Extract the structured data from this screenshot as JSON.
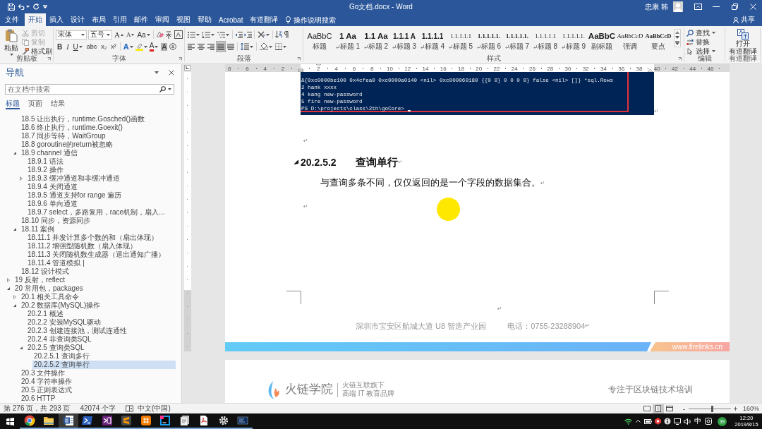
{
  "title_bar": {
    "title": "Go文档.docx - Word",
    "user": "忠康 韩"
  },
  "tabs": [
    {
      "label": "文件",
      "selected": false
    },
    {
      "label": "开始",
      "selected": true
    },
    {
      "label": "插入",
      "selected": false
    },
    {
      "label": "设计",
      "selected": false
    },
    {
      "label": "布局",
      "selected": false
    },
    {
      "label": "引用",
      "selected": false
    },
    {
      "label": "邮件",
      "selected": false
    },
    {
      "label": "审阅",
      "selected": false
    },
    {
      "label": "视图",
      "selected": false
    },
    {
      "label": "帮助",
      "selected": false
    },
    {
      "label": "Acrobat",
      "selected": false
    },
    {
      "label": "有道翻译",
      "selected": false
    }
  ],
  "tell_me": {
    "placeholder": "操作说明搜索"
  },
  "share": "共享",
  "ribbon": {
    "clipboard": {
      "paste": "粘贴",
      "buttons": [
        {
          "label": "剪切",
          "disabled": true
        },
        {
          "label": "复制",
          "disabled": true
        },
        {
          "label": "格式刷",
          "disabled": false
        }
      ],
      "group_label": "剪贴板"
    },
    "font": {
      "font_name": "宋体",
      "font_size": "五号",
      "grow": "A",
      "shrink": "A",
      "change_case": "Aa",
      "char_border": "A",
      "format_buttons": [
        "B",
        "I",
        "U",
        "abc",
        "x₂",
        "x²"
      ],
      "text_effects": "A",
      "font_color": "A",
      "char_shading": "A",
      "group_label": "字体"
    },
    "paragraph": {
      "align_buttons": [
        {
          "selected": false
        },
        {
          "selected": false
        },
        {
          "selected": false
        },
        {
          "selected": true
        },
        {
          "selected": false
        }
      ],
      "group_label": "段落"
    },
    "styles": {
      "items": [
        {
          "preview": "AaBbC",
          "label": "标题",
          "kind": "plain",
          "paragraph_mark": false
        },
        {
          "preview": "1 Aa",
          "label": "标题 1",
          "kind": "bold_large",
          "paragraph_mark": true
        },
        {
          "preview": "1.1 Aa",
          "label": "标题 2",
          "kind": "bold_large",
          "paragraph_mark": true
        },
        {
          "preview": "1.1.1 A",
          "label": "标题 3",
          "kind": "bold",
          "paragraph_mark": true
        },
        {
          "preview": "1.1.1.1",
          "label": "标题 4",
          "kind": "bold",
          "paragraph_mark": true
        },
        {
          "preview": "1.1.1.1.1",
          "label": "标题 5",
          "kind": "serif",
          "paragraph_mark": true
        },
        {
          "preview": "1.1.1.1.1.",
          "label": "标题 6",
          "kind": "bold_serif",
          "paragraph_mark": true
        },
        {
          "preview": "1.1.1.1.1.",
          "label": "标题 7",
          "kind": "bold_serif",
          "paragraph_mark": true
        },
        {
          "preview": "1.1.1.1.1",
          "label": "标题 8",
          "kind": "serif",
          "paragraph_mark": true
        },
        {
          "preview": "1.1.1.1.1.",
          "label": "标题 9",
          "kind": "serif",
          "paragraph_mark": true
        },
        {
          "preview": "AaBbC",
          "label": "副标题",
          "kind": "bold_large",
          "paragraph_mark": false
        },
        {
          "preview": "AaBbCcD",
          "label": "强调",
          "kind": "italic",
          "paragraph_mark": false
        },
        {
          "preview": "AaBbCcD",
          "label": "要点",
          "kind": "bold_serif",
          "paragraph_mark": false
        }
      ],
      "group_label": "样式"
    },
    "editing": {
      "buttons": [
        "查找",
        "替换",
        "选择"
      ],
      "group_label": "编辑"
    },
    "translate": {
      "button": [
        "打开",
        "有道翻译"
      ],
      "group_label": "有道翻译"
    }
  },
  "navigation": {
    "title": "导航",
    "search": {
      "placeholder": "在文档中搜索"
    },
    "tabs": [
      {
        "label": "标题",
        "selected": true
      },
      {
        "label": "页面",
        "selected": false
      },
      {
        "label": "结果",
        "selected": false
      }
    ],
    "headings": [
      {
        "children": [
          {
            "label": "18.5 让出执行，runtime.Gosched()函数",
            "selected": false
          },
          {
            "label": "18.6 终止执行，runtime.Goexit()",
            "selected": false
          },
          {
            "label": "18.7 同步等待，WaitGroup",
            "selected": false
          },
          {
            "label": "18.8 goroutine的return被忽略",
            "selected": false
          },
          {
            "label": "18.9 channel 通信",
            "selected": false,
            "expanded": true,
            "children": [
              {
                "label": "18.9.1 语法",
                "selected": false
              },
              {
                "label": "18.9.2 操作",
                "selected": false
              },
              {
                "label": "18.9.3 缓冲通道和非缓冲通道",
                "selected": false,
                "expanded": false
              },
              {
                "label": "18.9.4 关闭通道",
                "selected": false
              },
              {
                "label": "18.9.5 通道支持for range 遍历",
                "selected": false
              },
              {
                "label": "18.9.6 单向通道",
                "selected": false
              },
              {
                "label": "18.9.7 select，多路复用，race机制，扇入...",
                "selected": false
              }
            ]
          },
          {
            "label": "18.10 同步，资源同步",
            "selected": false
          },
          {
            "label": "18.11 案例",
            "selected": false,
            "expanded": true,
            "children": [
              {
                "label": "18.11.1 并发计算多个数的和（扇出体现）",
                "selected": false
              },
              {
                "label": "18.11.2 增强型随机数（扇入体现）",
                "selected": false
              },
              {
                "label": "18.11.3 关闭随机数生成器（退出通知广播）",
                "selected": false
              },
              {
                "label": "18.11.4 管道模拟 |",
                "selected": false
              }
            ]
          },
          {
            "label": "18.12 设计模式",
            "selected": false
          }
        ]
      },
      {
        "label": "19 反射，reflect",
        "selected": false,
        "expanded": false
      },
      {
        "label": "20 常用包，packages",
        "selected": false,
        "expanded": true,
        "children": [
          {
            "label": "20.1 相关工具命令",
            "selected": false,
            "expanded": false
          },
          {
            "label": "20.2 数据库(MySQL)操作",
            "selected": false,
            "expanded": true,
            "children": [
              {
                "label": "20.2.1 概述",
                "selected": false
              },
              {
                "label": "20.2.2 安装MySQL驱动",
                "selected": false
              },
              {
                "label": "20.2.3 创建连接池，测试连通性",
                "selected": false
              },
              {
                "label": "20.2.4 非查询类SQL",
                "selected": false
              },
              {
                "label": "20.2.5 查询类SQL",
                "selected": false,
                "expanded": true,
                "children": [
                  {
                    "label": "20.2.5.1 查询多行",
                    "selected": false
                  },
                  {
                    "label": "20.2.5.2 查询单行",
                    "selected": true
                  }
                ]
              }
            ]
          },
          {
            "label": "20.3 文件操作",
            "selected": false
          },
          {
            "label": "20.4 字符串操作",
            "selected": false
          },
          {
            "label": "20.5 正则表达式",
            "selected": false
          },
          {
            "label": "20.6 HTTP",
            "selected": false
          }
        ]
      }
    ]
  },
  "ruler": {
    "numbers": [
      "8",
      "6",
      "4",
      "2",
      "2",
      "4",
      "6",
      "8",
      "10",
      "12",
      "14",
      "16",
      "18",
      "20",
      "22",
      "24",
      "26",
      "28",
      "30",
      "32",
      "34",
      "36",
      "38",
      "40",
      "42",
      "44",
      "46"
    ]
  },
  "document": {
    "blocks": [
      {
        "kind": "terminal",
        "lines": [
          "&{0xc0000be100 0x4cfea0 0xc0000a0140 <nil> 0xc000060180 {{0 0} 0 0 0 0} false <nil> []} *sql.Rows",
          "2 hank xxxx",
          "4 kang new-password",
          "5 fire new-password",
          "PS D:\\projects\\class\\2th\\goCore>"
        ],
        "mark": "↵"
      },
      {
        "kind": "empty",
        "mark": "↵"
      },
      {
        "kind": "heading",
        "number": "20.2.5.2",
        "text": "查询单行",
        "mark": "↵"
      },
      {
        "kind": "body",
        "text": "与查询多条不同，仅仅返回的是一个字段的数据集合。",
        "mark": "↵"
      },
      {
        "kind": "empty",
        "mark": "↵"
      }
    ],
    "footer": {
      "mark": "↵",
      "address": "深圳市宝安区航城大道 U8 智造产业园",
      "phone": "电话：0755-23288904",
      "phone_mark": "↵",
      "website": "www.firelinks.cn"
    },
    "next_page": {
      "brand": "火链学院",
      "tagline": [
        "火链互联旗下",
        "高端 IT 教育品牌"
      ],
      "slogan": "专注于区块链技术培训"
    }
  },
  "status_bar": {
    "page": "第 276 页，共 293 页",
    "words": "42074 个字",
    "language": "中文(中国)",
    "views": [
      {
        "selected": false
      },
      {
        "selected": true
      },
      {
        "selected": false
      }
    ],
    "zoom_out": "-",
    "zoom_slider": {
      "level": 0.55
    },
    "zoom_in": "+",
    "zoom": "160%"
  },
  "taskbar": {
    "apps": [
      {
        "running": true,
        "selected": false
      },
      {
        "running": true,
        "selected": false
      },
      {
        "running": true,
        "selected": true
      },
      {
        "running": true,
        "selected": false
      },
      {
        "running": true,
        "selected": false
      },
      {
        "running": true,
        "selected": false
      },
      {
        "running": true,
        "selected": false
      },
      {
        "running": true,
        "selected": false
      },
      {
        "running": true,
        "selected": false
      },
      {
        "running": true,
        "selected": false
      },
      {
        "running": true,
        "selected": false
      },
      {
        "running": true,
        "selected": false
      }
    ],
    "ime": "中",
    "badge": "39",
    "time": "12:20",
    "date": "2019/8/15"
  }
}
